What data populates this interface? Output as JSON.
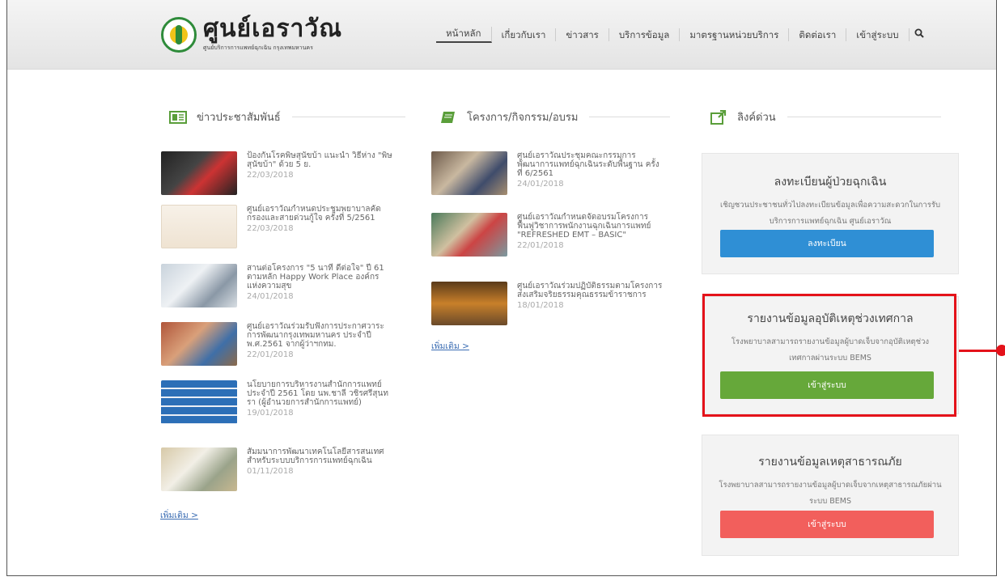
{
  "site": {
    "title": "ศูนย์เอราวัณ",
    "subtitle": "ศูนย์บริการการแพทย์ฉุกเฉิน กรุงเทพมหานคร"
  },
  "nav": {
    "items": [
      "หน้าหลัก",
      "เกี่ยวกับเรา",
      "ข่าวสาร",
      "บริการข้อมูล",
      "มาตรฐานหน่วยบริการ",
      "ติดต่อเรา",
      "เข้าสู่ระบบ"
    ],
    "search_icon": "search-icon"
  },
  "columns": {
    "pr": {
      "heading": "ข่าวประชาสัมพันธ์",
      "icon": "newspaper-icon",
      "more": "เพิ่มเติม >"
    },
    "projects": {
      "heading": "โครงการ/กิจกรรม/อบรม",
      "icon": "book-icon",
      "more": "เพิ่มเติม >"
    },
    "links": {
      "heading": "ลิงค์ด่วน",
      "icon": "external-link-icon"
    }
  },
  "pr_news": [
    {
      "title": "ป้องกันโรคพิษสุนัขบ้า แนะนำ วิธีห่าง \"พิษสุนัขบ้า\" ด้วย 5 ย.",
      "date": "22/03/2018"
    },
    {
      "title": "ศูนย์เอราวัณกำหนดประชุมพยาบาลคัดกรองและสายด่วนกู้ใจ ครั้งที่ 5/2561",
      "date": "22/03/2018"
    },
    {
      "title": "สานต่อโครงการ \"5 นาที ดีต่อใจ\" ปี 61 ตามหลัก Happy Work Place องค์กรแห่งความสุข",
      "date": "24/01/2018"
    },
    {
      "title": "ศูนย์เอราวัณร่วมรับฟังการประกาศวาระการพัฒนากรุงเทพมหานคร ประจำปี พ.ศ.2561 จากผู้ว่าฯกทม.",
      "date": "22/01/2018"
    },
    {
      "title": "นโยบายการบริหารงานสำนักการแพทย์ ประจำปี 2561 โดย นพ.ชาลี วชิรศรีสุนทรา (ผู้อำนวยการสำนักการแพทย์)",
      "date": "19/01/2018"
    },
    {
      "title": "สัมมนาการพัฒนาเทคโนโลยีสารสนเทศสำหรับระบบบริการการแพทย์ฉุกเฉิน",
      "date": "01/11/2018"
    }
  ],
  "project_news": [
    {
      "title": "ศูนย์เอราวัณประชุมคณะกรรมการพัฒนาการแพทย์ฉุกเฉินระดับพื้นฐาน ครั้งที่ 6/2561",
      "date": "24/01/2018"
    },
    {
      "title": "ศูนย์เอราวัณกำหนดจัดอบรมโครงการฟื้นฟูวิชาการพนักงานฉุกเฉินการแพทย์ \"REFRESHED EMT – BASIC\"",
      "date": "22/01/2018"
    },
    {
      "title": "ศูนย์เอราวัณร่วมปฏิบัติธรรมตามโครงการส่งเสริมจริยธรรมคุณธรรมข้าราชการ",
      "date": "18/01/2018"
    }
  ],
  "cards": [
    {
      "title": "ลงทะเบียนผู้ป่วยฉุกเฉิน",
      "desc": "เชิญชวนประชาชนทั่วไปลงทะเบียนข้อมูลเพื่อความสะดวกในการรับบริการการแพทย์ฉุกเฉิน ศูนย์เอราวัณ",
      "button": "ลงทะเบียน",
      "color": "#2f8fd5"
    },
    {
      "title": "รายงานข้อมูลอุบัติเหตุช่วงเทศกาล",
      "desc": "โรงพยาบาลสามารถรายงานข้อมูลผู้บาดเจ็บจากอุบัติเหตุช่วงเทศกาลผ่านระบบ BEMS",
      "button": "เข้าสู่ระบบ",
      "color": "#66a83a"
    },
    {
      "title": "รายงานข้อมูลเหตุสาธารณภัย",
      "desc": "โรงพยาบาลสามารถรายงานข้อมูลผู้บาดเจ็บจากเหตุสาธารณภัยผ่านระบบ BEMS",
      "button": "เข้าสู่ระบบ",
      "color": "#f25f5c"
    }
  ],
  "annotation": {
    "highlight_color": "#e4121a"
  }
}
